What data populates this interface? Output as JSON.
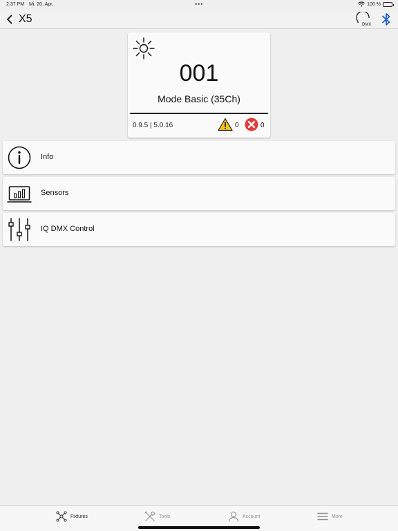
{
  "status_bar": {
    "time": "2:37 PM",
    "date": "Mi. 20. Apr.",
    "battery_text": "100 %",
    "battery_level": 1.0
  },
  "nav": {
    "title": "X5",
    "dmx_label": "DMX"
  },
  "fixture": {
    "address": "001",
    "mode": "Mode Basic (35Ch)",
    "version": "0.9.5 | 5.0.16",
    "warnings": "0",
    "errors": "0"
  },
  "menu": [
    {
      "label": "Info",
      "icon": "info-icon"
    },
    {
      "label": "Sensors",
      "icon": "sensors-icon"
    },
    {
      "label": "IQ DMX Control",
      "icon": "sliders-icon"
    }
  ],
  "tabs": [
    {
      "label": "Fixtures",
      "icon": "fixtures-icon",
      "active": true
    },
    {
      "label": "Tools",
      "icon": "tools-icon",
      "active": false
    },
    {
      "label": "Account",
      "icon": "account-icon",
      "active": false
    },
    {
      "label": "More",
      "icon": "menu-icon",
      "active": false
    }
  ],
  "colors": {
    "accent_blue": "#1a63c9",
    "warning_yellow": "#f5c518",
    "error_red": "#e23b3b",
    "background": "#efefef"
  }
}
